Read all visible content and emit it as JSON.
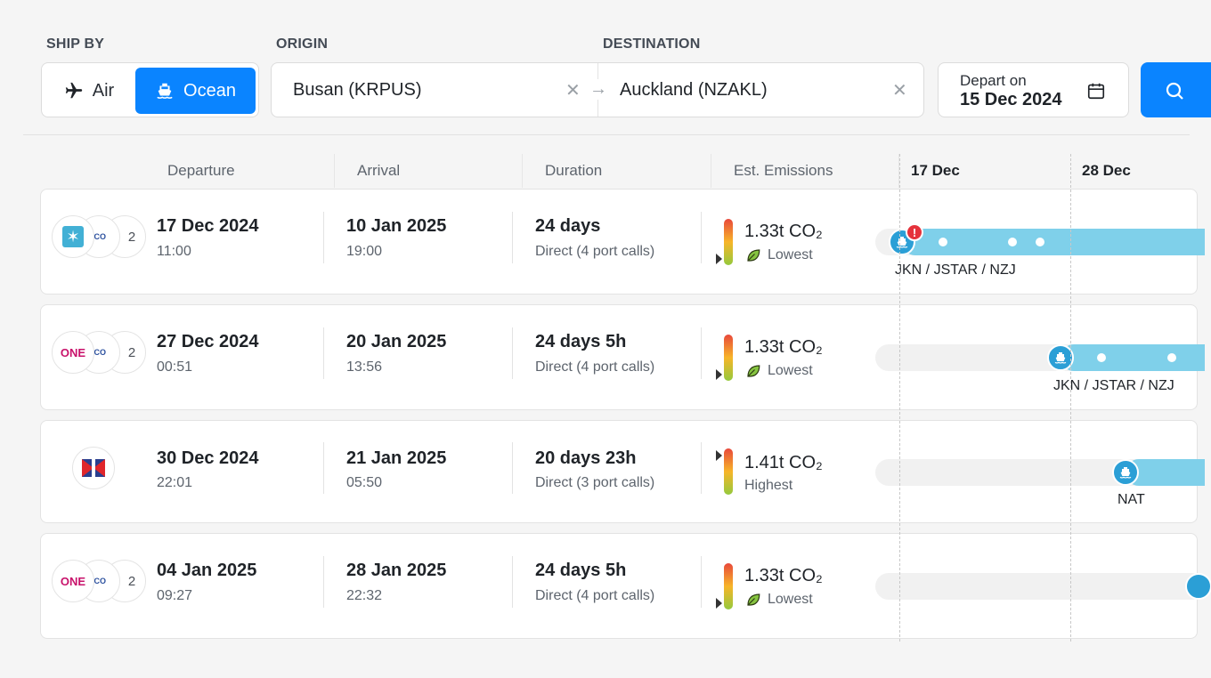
{
  "search": {
    "ship_by_label": "SHIP BY",
    "origin_label": "ORIGIN",
    "destination_label": "DESTINATION",
    "modes": [
      {
        "label": "Air",
        "icon": "plane-icon",
        "selected": false
      },
      {
        "label": "Ocean",
        "icon": "ship-icon",
        "selected": true
      }
    ],
    "origin_value": "Busan (KRPUS)",
    "destination_value": "Auckland (NZAKL)",
    "depart_label": "Depart on",
    "depart_value": "15 Dec 2024"
  },
  "columns": {
    "departure": "Departure",
    "arrival": "Arrival",
    "duration": "Duration",
    "emissions": "Est. Emissions",
    "timeline_1": "17 Dec",
    "timeline_2": "28 Dec"
  },
  "results": [
    {
      "carriers": [
        "star-logo",
        "ico-logo"
      ],
      "carrier_more": "2",
      "dep_date": "17 Dec 2024",
      "dep_time": "11:00",
      "arr_date": "10 Jan 2025",
      "arr_time": "19:00",
      "duration": "24 days",
      "stops": "Direct (4 port calls)",
      "co2": "1.33t CO₂",
      "rating": "Lowest",
      "route": "JKN / JSTAR / NZJ",
      "alert": "!"
    },
    {
      "carriers": [
        "one-logo",
        "ico-logo"
      ],
      "carrier_more": "2",
      "dep_date": "27 Dec 2024",
      "dep_time": "00:51",
      "arr_date": "20 Jan 2025",
      "arr_time": "13:56",
      "duration": "24 days 5h",
      "stops": "Direct (4 port calls)",
      "co2": "1.33t CO₂",
      "rating": "Lowest",
      "route": "JKN / JSTAR / NZJ"
    },
    {
      "carriers": [
        "flag-logo"
      ],
      "dep_date": "30 Dec 2024",
      "dep_time": "22:01",
      "arr_date": "21 Jan 2025",
      "arr_time": "05:50",
      "duration": "20 days 23h",
      "stops": "Direct (3 port calls)",
      "co2": "1.41t CO₂",
      "rating": "Highest",
      "route": "NAT"
    },
    {
      "carriers": [
        "one-logo",
        "ico-logo"
      ],
      "carrier_more": "2",
      "dep_date": "04 Jan 2025",
      "dep_time": "09:27",
      "arr_date": "28 Jan 2025",
      "arr_time": "22:32",
      "duration": "24 days 5h",
      "stops": "Direct (4 port calls)",
      "co2": "1.33t CO₂",
      "rating": "Lowest"
    }
  ],
  "colors": {
    "accent": "#0a84ff",
    "route_bar": "#7fd0ea",
    "ship_marker": "#2b9fd6",
    "alert": "#e5323b"
  }
}
